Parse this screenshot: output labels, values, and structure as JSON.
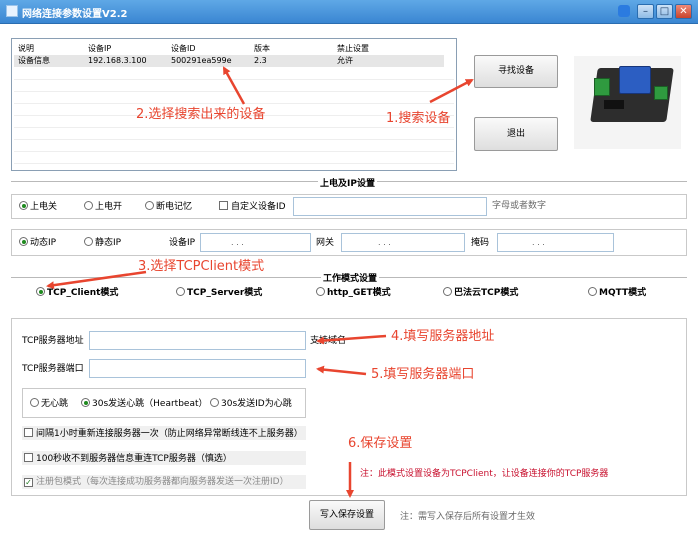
{
  "window": {
    "title": "网络连接参数设置V2.2"
  },
  "device_list": {
    "columns": [
      "说明",
      "设备IP",
      "设备ID",
      "版本",
      "禁止设置"
    ],
    "rows": [
      {
        "desc": "设备信息",
        "ip": "192.168.3.100",
        "id": "500291ea599e",
        "version": "2.3",
        "forbid": "允许"
      }
    ]
  },
  "buttons": {
    "search": "寻找设备",
    "exit": "退出",
    "save": "写入保存设置"
  },
  "power_ip_group": {
    "title": "上电及IP设置",
    "power_options": [
      "上电关",
      "上电开",
      "断电记忆"
    ],
    "power_selected": 0,
    "custom_id_label": "自定义设备ID",
    "custom_id_checked": false,
    "custom_id_value": "",
    "custom_id_hint": "字母或者数字",
    "ip_options": [
      "动态IP",
      "静态IP"
    ],
    "ip_selected": 0,
    "device_ip_label": "设备IP",
    "gateway_label": "网关",
    "mask_label": "掩码",
    "ip_dots": ".  .  ."
  },
  "work_mode_group": {
    "title": "工作模式设置",
    "options": [
      "TCP_Client模式",
      "TCP_Server模式",
      "http_GET模式",
      "巴法云TCP模式",
      "MQTT模式"
    ],
    "selected": 0
  },
  "tcp_settings": {
    "server_addr_label": "TCP服务器地址",
    "server_addr_value": "",
    "server_addr_hint": "支持域名",
    "server_port_label": "TCP服务器端口",
    "server_port_value": "",
    "heartbeat_options": [
      "无心跳",
      "30s发送心跳（Heartbeat）",
      "30s发送ID为心跳"
    ],
    "heartbeat_selected": 1,
    "reconnect_label": "间隔1小时重新连接服务器一次（防止网络异常断线连不上服务器）",
    "reconnect_checked": false,
    "reconnect100_label": "100秒收不到服务器信息重连TCP服务器（慎选）",
    "reconnect100_checked": false,
    "register_label": "注册包模式（每次连接成功服务器都向服务器发送一次注册ID）",
    "register_checked": true
  },
  "footer": {
    "note": "注：此模式设置设备为TCPClient，让设备连接你的TCP服务器",
    "save_hint": "注：需写入保存后所有设置才生效"
  },
  "annotations": {
    "a1": "1.搜索设备",
    "a2": "2.选择搜索出来的设备",
    "a3": "3.选择TCPClient模式",
    "a4": "4.填写服务器地址",
    "a5": "5.填写服务器端口",
    "a6": "6.保存设置"
  },
  "colors": {
    "annotation": "#e8452f",
    "titlebar": "#3a86d2",
    "radio_dot": "#1f8a1f"
  },
  "icons": {
    "title": "app-window-icon",
    "skin": "tshirt-icon",
    "minimize": "minimize-icon",
    "maximize": "maximize-icon",
    "close": "close-icon"
  }
}
